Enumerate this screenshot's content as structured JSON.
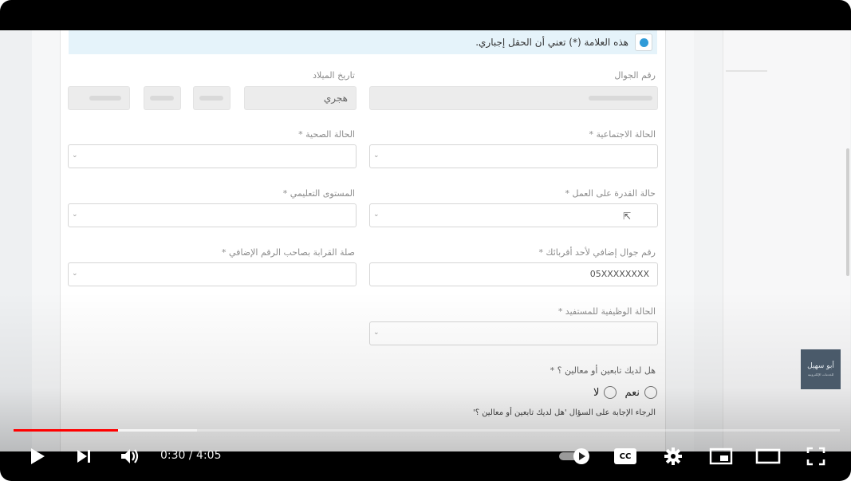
{
  "form": {
    "notice": "هذه العلامة (*) تعني أن الحقل إجباري.",
    "birth_date_label": "تاريخ الميلاد",
    "calendar_value": "هجري",
    "mobile_label": "رقم الجوال",
    "health_label": "الحالة الصحية *",
    "social_label": "الحالة الاجتماعية *",
    "education_label": "المستوى التعليمي *",
    "work_ability_label": "حالة القدرة على العمل *",
    "relation_label": "صلة القرابة بصاحب الرقم الإضافي *",
    "extra_mobile_label": "رقم جوال إضافي لأحد أقربائك *",
    "extra_mobile_placeholder": "05XXXXXXXX",
    "employment_label": "الحالة الوظيفية للمستفيد *",
    "dependents_question": "هل لديك تابعين أو معالين ؟ *",
    "yes_label": "نعم",
    "no_label": "لا",
    "dependents_hint": "الرجاء الإجابة على السؤال 'هل لديك تابعين أو معالين ؟'"
  },
  "logo": {
    "line1": "أبو سهيل",
    "line2": "للخدمات الإلكترونية"
  },
  "player": {
    "time_display": "0:30 / 4:05",
    "played_fraction": 0.126,
    "buffered_fraction": 0.222,
    "icons": [
      "play-icon",
      "next-icon",
      "volume-icon",
      "autoplay-toggle-icon",
      "captions-icon",
      "settings-icon",
      "miniplayer-icon",
      "theater-icon",
      "fullscreen-icon"
    ],
    "progress_color": "#ff0000",
    "captions_label": "CC"
  }
}
